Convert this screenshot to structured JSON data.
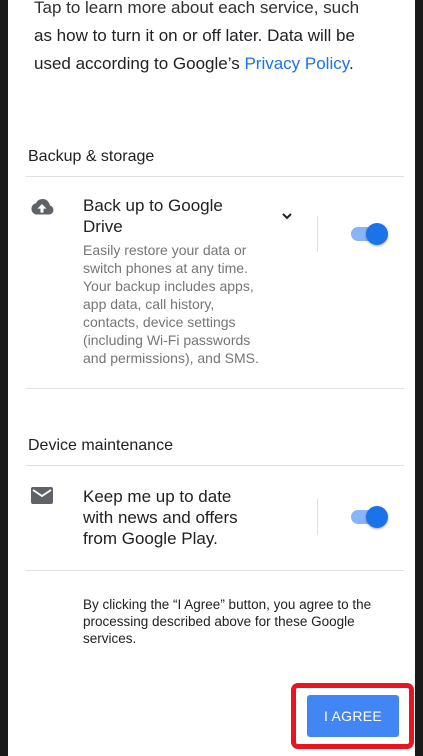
{
  "intro": {
    "line0": "Tap to learn more about each service, such",
    "line1": "as how to turn it on or off later. Data will be",
    "line2_prefix": "used according to Google’s ",
    "privacy_link": "Privacy Policy",
    "line2_suffix": "."
  },
  "backup": {
    "section_title": "Backup & storage",
    "item_title": "Back up to Google Drive",
    "item_description": "Easily restore your data or switch phones at any time. Your backup includes apps, app data, call history, contacts, device settings (including Wi-Fi passwords and permissions), and SMS.",
    "icon": "cloud-upload-icon",
    "expand_icon": "chevron-down-icon",
    "toggle_on": true
  },
  "maintenance": {
    "section_title": "Device maintenance",
    "item_title": "Keep me up to date with news and offers from Google Play.",
    "icon": "email-icon",
    "toggle_on": true
  },
  "consent_text": "By clicking the “I Agree” button, you agree to the processing described above for these Google services.",
  "agree_button": {
    "label": "I AGREE"
  },
  "colors": {
    "accent": "#1a73e8",
    "button": "#4285f4",
    "highlight": "#e8141e"
  }
}
